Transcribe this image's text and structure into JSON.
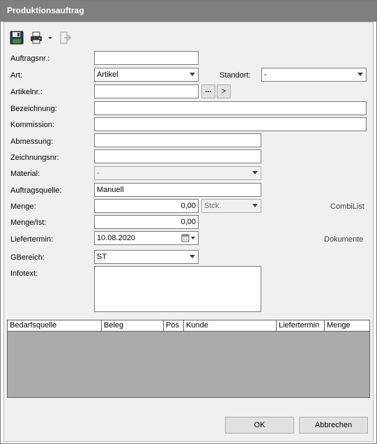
{
  "window": {
    "title": "Produktionsauftrag"
  },
  "toolbar": {
    "save_icon": "floppy-disk-icon",
    "print_icon": "printer-icon",
    "print_dropdown_icon": "dropdown-arrow-icon",
    "exit_icon": "exit-arrow-icon"
  },
  "form": {
    "auftragsnr": {
      "label": "Auftragsnr.:",
      "value": ""
    },
    "art": {
      "label": "Art:",
      "value": "Artikel"
    },
    "standort": {
      "label": "Standort:",
      "value": "-"
    },
    "artikelnr": {
      "label": "Artikelnr.:",
      "value": "",
      "browse_label": "...",
      "go_label": ">"
    },
    "bezeichnung": {
      "label": "Bezeichnung:",
      "value": ""
    },
    "kommission": {
      "label": "Kommission:",
      "value": ""
    },
    "abmessung": {
      "label": "Abmessung:",
      "value": ""
    },
    "zeichnungsnr": {
      "label": "Zeichnungsnr:",
      "value": ""
    },
    "material": {
      "label": "Material:",
      "value": "-"
    },
    "auftragsquelle": {
      "label": "Auftragsquelle:",
      "value": "Manuell"
    },
    "menge": {
      "label": "Menge:",
      "value": "0,00",
      "unit": "Stck."
    },
    "menge_ist": {
      "label": "Menge/Ist:",
      "value": "0,00"
    },
    "liefertermin": {
      "label": "Liefertermin:",
      "value": "10.08.2020"
    },
    "gbereich": {
      "label": "GBereich:",
      "value": "ST"
    },
    "infotext": {
      "label": "Infotext:",
      "value": ""
    }
  },
  "links": {
    "combilist": "CombiList",
    "dokumente": "Dokumente"
  },
  "grid": {
    "columns": [
      "Bedarfsquelle",
      "Beleg",
      "Pos",
      "Kunde",
      "Liefertermin",
      "Menge"
    ],
    "rows": []
  },
  "buttons": {
    "ok": "OK",
    "cancel": "Abbrechen"
  }
}
